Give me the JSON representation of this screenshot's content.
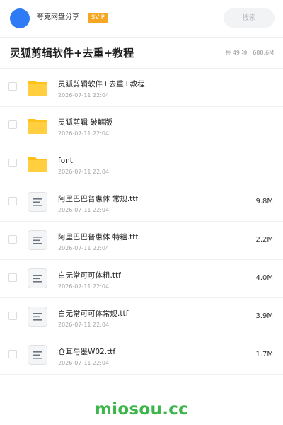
{
  "header": {
    "brand": "夸克网盘分享",
    "badge": "SVIP",
    "search_label": "搜索"
  },
  "colors": {
    "avatar": "#2f7bf6",
    "badge": "#f5a623",
    "folder": "#ffc21a",
    "watermark": "#3cb54a"
  },
  "title_bar": {
    "title": "灵狐剪辑软件+去重+教程",
    "summary": "共 49 项 · 688.6M"
  },
  "files": [
    {
      "type": "folder-icon",
      "name": "灵狐剪辑软件+去重+教程",
      "date": "2026-07-11 22:04",
      "size": ""
    },
    {
      "type": "folder-icon",
      "name": "灵狐剪辑 破解版",
      "date": "2026-07-11 22:04",
      "size": ""
    },
    {
      "type": "folder-icon",
      "name": "font",
      "date": "2026-07-11 22:04",
      "size": ""
    },
    {
      "type": "file-icon",
      "name": "阿里巴巴普惠体 常规.ttf",
      "date": "2026-07-11 22:04",
      "size": "9.8M"
    },
    {
      "type": "file-icon",
      "name": "阿里巴巴普惠体 特粗.ttf",
      "date": "2026-07-11 22:04",
      "size": "2.2M"
    },
    {
      "type": "file-icon",
      "name": "白无常可可体粗.ttf",
      "date": "2026-07-11 22:04",
      "size": "4.0M"
    },
    {
      "type": "file-icon",
      "name": "白无常可可体常规.ttf",
      "date": "2026-07-11 22:04",
      "size": "3.9M"
    },
    {
      "type": "file-icon",
      "name": "仓耳与墨W02.ttf",
      "date": "2026-07-11 22:04",
      "size": "1.7M"
    }
  ],
  "watermark": "miosou.cc"
}
